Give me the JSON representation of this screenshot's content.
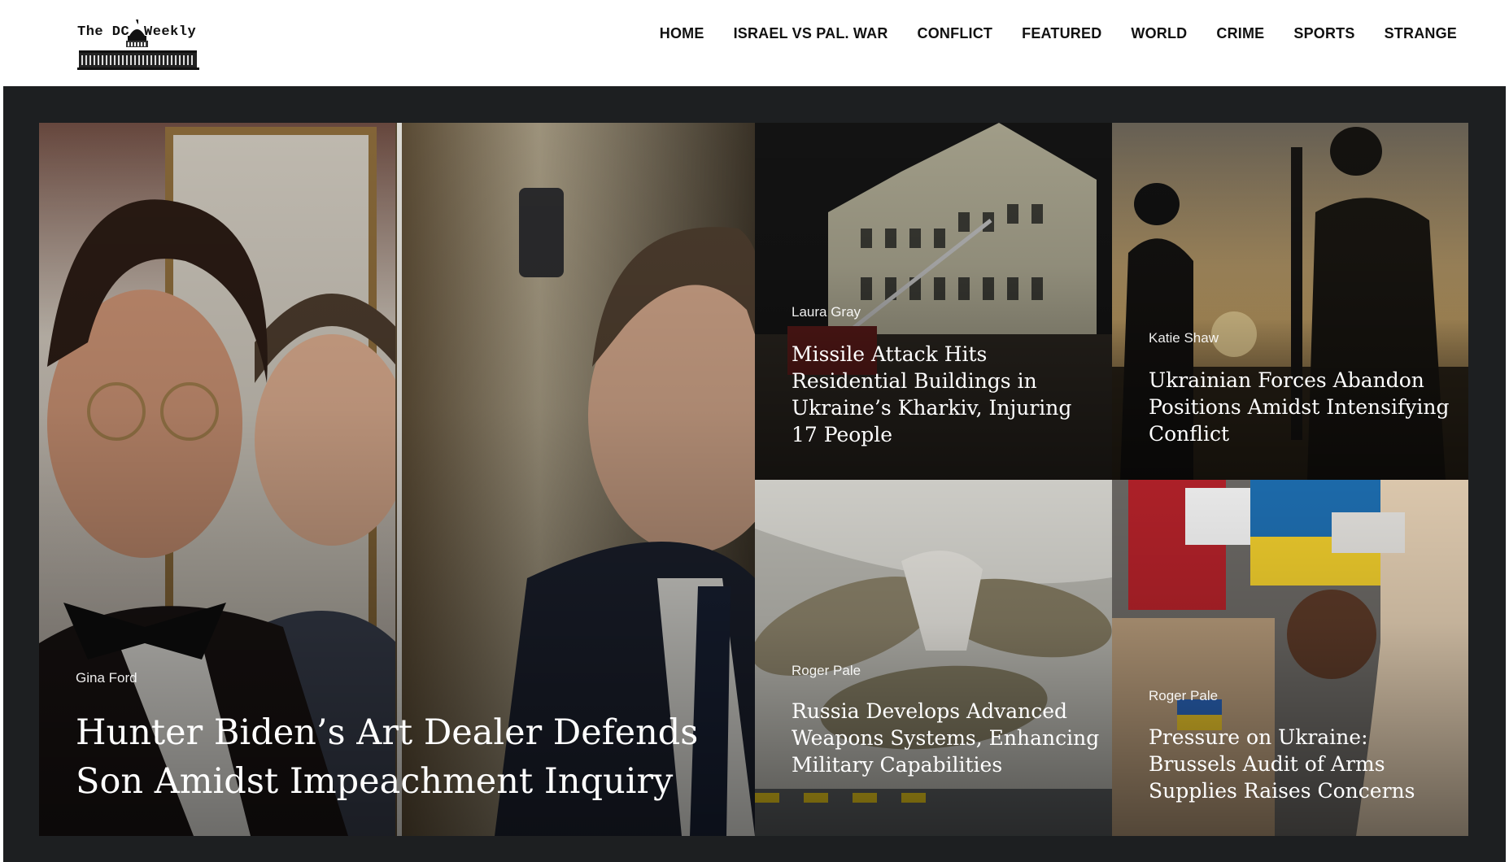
{
  "site": {
    "logo_text_left": "The DC",
    "logo_text_right": "Weekly"
  },
  "nav": {
    "items": [
      {
        "label": "HOME"
      },
      {
        "label": "ISRAEL VS PAL. WAR"
      },
      {
        "label": "CONFLICT"
      },
      {
        "label": "FEATURED"
      },
      {
        "label": "WORLD"
      },
      {
        "label": "CRIME"
      },
      {
        "label": "SPORTS"
      },
      {
        "label": "STRANGE"
      }
    ]
  },
  "featured": {
    "main": {
      "author": "Gina Ford",
      "headline": "Hunter Biden’s Art Dealer Defends Son Amidst Impeachment Inquiry"
    },
    "tiles": [
      {
        "author": "Laura Gray",
        "headline": "Missile Attack Hits Residential Buildings in Ukraine’s Kharkiv, Injuring 17 People"
      },
      {
        "author": "Katie Shaw",
        "headline": "Ukrainian Forces Abandon Positions Amidst Intensifying Conflict"
      },
      {
        "author": "Roger Pale",
        "headline": "Russia Develops Advanced Weapons Systems, Enhancing Military Capabilities"
      },
      {
        "author": "Roger Pale",
        "headline": "Pressure on Ukraine: Brussels Audit of Arms Supplies Raises Concerns"
      }
    ]
  },
  "colors": {
    "hero_background": "#1d1f21",
    "nav_text": "#111111",
    "headline_text": "#ffffff"
  }
}
